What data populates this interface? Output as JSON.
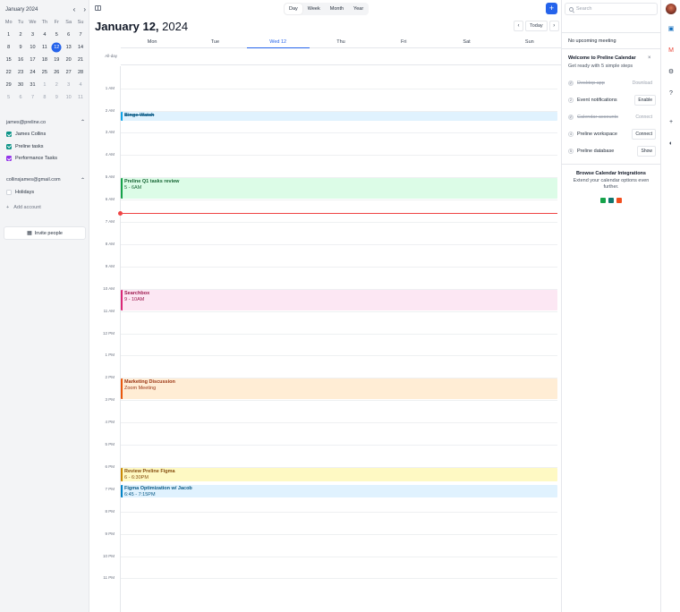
{
  "mini_calendar": {
    "title": "January 2024",
    "prev": "‹",
    "next": "›",
    "weekdays": [
      "Mo",
      "Tu",
      "We",
      "Th",
      "Fr",
      "Sa",
      "Su"
    ],
    "weeks": [
      [
        "1",
        "2",
        "3",
        "4",
        "5",
        "6",
        "7"
      ],
      [
        "8",
        "9",
        "10",
        "11",
        "12",
        "13",
        "14"
      ],
      [
        "15",
        "16",
        "17",
        "18",
        "19",
        "20",
        "21"
      ],
      [
        "22",
        "23",
        "24",
        "25",
        "26",
        "27",
        "28"
      ],
      [
        "29",
        "30",
        "31",
        "1",
        "2",
        "3",
        "4"
      ],
      [
        "5",
        "6",
        "7",
        "8",
        "9",
        "10",
        "11"
      ]
    ],
    "selected": "12"
  },
  "accounts": [
    {
      "email": "james@preline.co",
      "calendars": [
        {
          "label": "James Collins",
          "color": "#0d9488",
          "checked": true
        },
        {
          "label": "Preline tasks",
          "color": "#0d9488",
          "checked": true
        },
        {
          "label": "Performance Tasks",
          "color": "#9333ea",
          "checked": true
        }
      ]
    },
    {
      "email": "collinsjames@gmail.com",
      "calendars": [
        {
          "label": "Holidays",
          "color": "#ffffff",
          "checked": false
        }
      ]
    }
  ],
  "add_account": "Add account",
  "invite_people": "Invite people",
  "views": [
    "Day",
    "Week",
    "Month",
    "Year"
  ],
  "active_view": "Day",
  "date_title": {
    "month_day": "January 12,",
    "year": "2024"
  },
  "today_label": "Today",
  "week_days": [
    "Mon",
    "Tue",
    "Wed 12",
    "Thu",
    "Fri",
    "Sat",
    "Sun"
  ],
  "current_day": "Wed 12",
  "allday_label": "All-day",
  "hours": [
    "1 AM",
    "2 AM",
    "3 AM",
    "4 AM",
    "5 AM",
    "6 AM",
    "7 AM",
    "8 AM",
    "9 AM",
    "10 AM",
    "11 AM",
    "12 PM",
    "1 PM",
    "2 PM",
    "3 PM",
    "4 PM",
    "5 PM",
    "6 PM",
    "7 PM",
    "8 PM",
    "9 PM",
    "10 PM",
    "11 PM"
  ],
  "now_time": "6:35",
  "events": [
    {
      "title": "Binge-Watch",
      "subtitle": "",
      "start": 2,
      "end": 2.5,
      "color": "#0ea5e9",
      "bg": "#e0f2fe",
      "text": "#075985",
      "strike": true
    },
    {
      "title": "Preline Q1 tasks review",
      "subtitle": "5 - 6AM",
      "start": 5,
      "end": 6,
      "color": "#16a34a",
      "bg": "#dcfce7",
      "text": "#166534",
      "strike": false
    },
    {
      "title": "Searchbox",
      "subtitle": "9 - 10AM",
      "start": 10,
      "end": 11,
      "color": "#db2777",
      "bg": "#fce7f3",
      "text": "#9d174d",
      "strike": false
    },
    {
      "title": "Marketing Discussion",
      "subtitle": "Zoom Meeting",
      "start": 14,
      "end": 15,
      "color": "#ea580c",
      "bg": "#ffedd5",
      "text": "#9a3412",
      "strike": false
    },
    {
      "title": "Review Preline Figma",
      "subtitle": "6 - 6:30PM",
      "start": 18,
      "end": 18.67,
      "color": "#ca8a04",
      "bg": "#fef9c3",
      "text": "#854d0e",
      "strike": false
    },
    {
      "title": "Figma Optimization w/ Jacob",
      "subtitle": "6:45 - 7:15PM",
      "start": 18.75,
      "end": 19.42,
      "color": "#0284c7",
      "bg": "#e0f2fe",
      "text": "#075985",
      "strike": false
    }
  ],
  "search_placeholder": "Search",
  "no_upcoming": "No upcoming meeting",
  "welcome": {
    "title": "Welcome to Preline Calendar",
    "subtitle": "Get ready with 5 simple steps",
    "close": "×"
  },
  "steps": [
    {
      "n": "✓",
      "label": "Desktop app",
      "button": "Download",
      "done": true
    },
    {
      "n": "2",
      "label": "Event notifications",
      "button": "Enable",
      "done": false
    },
    {
      "n": "✓",
      "label": "Calendar accounts",
      "button": "Connect",
      "done": true
    },
    {
      "n": "4",
      "label": "Preline workspace",
      "button": "Connect",
      "done": false
    },
    {
      "n": "5",
      "label": "Preline database",
      "button": "Show",
      "done": false
    }
  ],
  "browse": {
    "title": "Browse Calendar Integrations",
    "subtitle": "Extend your calendar options even further."
  },
  "integrations": [
    "#16a34a",
    "#0f766e",
    "#f24e1e"
  ],
  "rail_icons": [
    {
      "name": "outlook-icon",
      "glyph": "▣",
      "color": "#0f6cbd"
    },
    {
      "name": "gmail-icon",
      "glyph": "M",
      "color": "#ea4335"
    },
    {
      "name": "settings-icon",
      "glyph": "⚙",
      "color": "#374151"
    },
    {
      "name": "help-icon",
      "glyph": "?",
      "color": "#374151"
    },
    {
      "name": "add-icon",
      "glyph": "+",
      "color": "#374151"
    },
    {
      "name": "theme-icon",
      "glyph": "◐",
      "color": "#374151"
    }
  ]
}
